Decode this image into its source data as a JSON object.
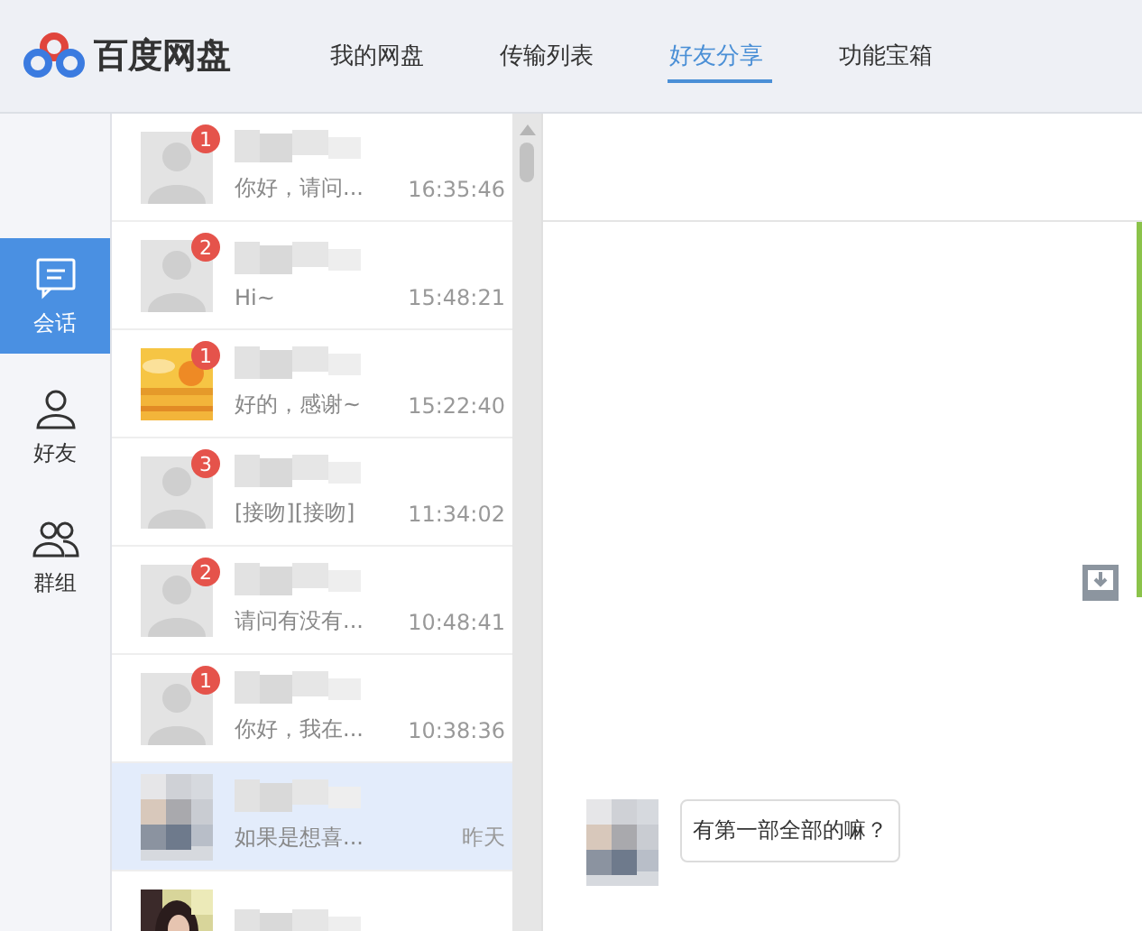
{
  "app": {
    "name": "百度网盘"
  },
  "tabs": [
    {
      "label": "我的网盘",
      "selected": false
    },
    {
      "label": "传输列表",
      "selected": false
    },
    {
      "label": "好友分享",
      "selected": true
    },
    {
      "label": "功能宝箱",
      "selected": false
    }
  ],
  "sidebar": {
    "items": [
      {
        "kind": "chat",
        "label": "会话",
        "selected": true
      },
      {
        "kind": "friends",
        "label": "好友",
        "selected": false
      },
      {
        "kind": "groups",
        "label": "群组",
        "selected": false
      }
    ]
  },
  "conversations": [
    {
      "avatar": {
        "kind": "silhouette"
      },
      "badge": "1",
      "preview": "你好，请问...",
      "time": "16:35:46",
      "selected": false
    },
    {
      "avatar": {
        "kind": "silhouette"
      },
      "badge": "2",
      "preview": "Hi~",
      "time": "15:48:21",
      "selected": false
    },
    {
      "avatar": {
        "kind": "sunset"
      },
      "badge": "1",
      "preview": "好的，感谢~",
      "time": "15:22:40",
      "selected": false
    },
    {
      "avatar": {
        "kind": "silhouette"
      },
      "badge": "3",
      "preview": "[接吻][接吻]",
      "time": "11:34:02",
      "selected": false
    },
    {
      "avatar": {
        "kind": "silhouette"
      },
      "badge": "2",
      "preview": "请问有没有...",
      "time": "10:48:41",
      "selected": false
    },
    {
      "avatar": {
        "kind": "silhouette"
      },
      "badge": "1",
      "preview": "你好，我在...",
      "time": "10:38:36",
      "selected": false
    },
    {
      "avatar": {
        "kind": "pixelated"
      },
      "preview": "如果是想喜...",
      "time": "昨天",
      "selected": true
    },
    {
      "selected": false
    }
  ],
  "messages": [
    {
      "avatar": {
        "kind": "pixelated"
      },
      "text": "有第一部全部的嘛？"
    }
  ]
}
